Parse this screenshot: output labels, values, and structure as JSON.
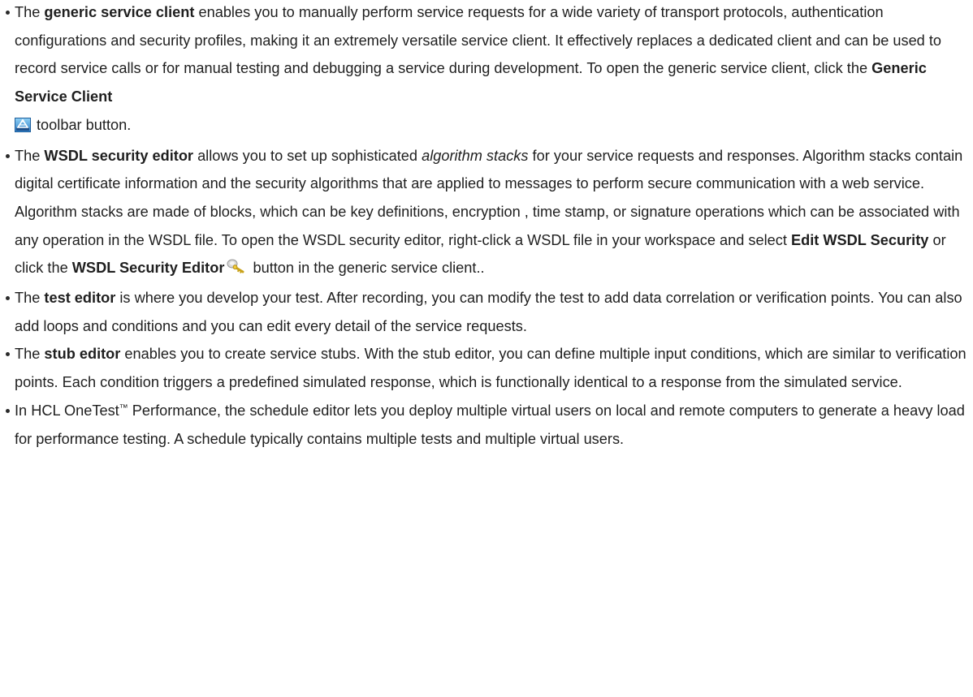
{
  "items": [
    {
      "intro": "The ",
      "term": "generic service client",
      "text1": " enables you to manually perform service requests for a wide variety of transport protocols, authentication configurations and security profiles, making it an extremely versatile service client. It effectively replaces a dedicated client and can be used to record service calls or for manual testing and debugging a service during development. To open the generic service client, click the ",
      "button": "Generic Service Client",
      "icon": "generic-service-client-icon",
      "text2": "toolbar button."
    },
    {
      "intro": "The ",
      "term": "WSDL security editor",
      "text1": " allows you to set up sophisticated ",
      "em": "algorithm stacks",
      "text2": " for your service requests and responses. Algorithm stacks contain digital certificate information and the security algorithms that are applied to messages to perform secure communication with a web service. Algorithm stacks are made of blocks, which can be key definitions, encryption , time stamp, or signature operations which can be associated with any operation in the WSDL file. To open the WSDL security editor, right-click a WSDL file in your workspace and select ",
      "action": "Edit WSDL Security",
      "text3": " or click the ",
      "button": "WSDL Security Editor",
      "icon": "wsdl-security-editor-icon",
      "text4": " button in the generic service client.."
    },
    {
      "intro": "The ",
      "term": "test editor",
      "text1": " is where you develop your test. After recording, you can modify the test to add data correlation or verification points. You can also add loops and conditions and you can edit every detail of the service requests."
    },
    {
      "intro": "The ",
      "term": "stub editor",
      "text1": " enables you to create service stubs. With the stub editor, you can define multiple input conditions, which are similar to verification points. Each condition triggers a predefined simulated response, which is functionally identical to a response from the simulated service."
    },
    {
      "text1": "In HCL OneTest",
      "tm": "™",
      "text2": " Performance, the schedule editor lets you deploy multiple virtual users on local and remote computers to generate a heavy load for performance testing. A schedule typically contains multiple tests and multiple virtual users."
    }
  ]
}
